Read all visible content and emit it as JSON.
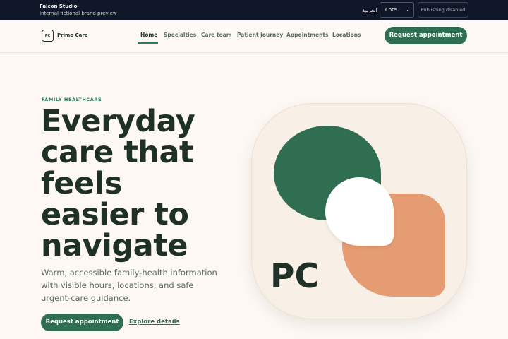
{
  "topbar": {
    "studio": "Falcon Studio",
    "preview": "Internal fictional brand preview",
    "language": "العربية",
    "theme_select": "Core",
    "publishing": "Publishing disabled"
  },
  "header": {
    "logo_initials": "PC",
    "brand_name": "Prime Care",
    "nav": [
      "Home",
      "Specialties",
      "Care team",
      "Patient journey",
      "Appointments",
      "Locations"
    ],
    "active_nav": "Home",
    "cta": "Request appointment"
  },
  "hero": {
    "eyebrow": "FAMILY HEALTHCARE",
    "headline_lines": [
      "Everyday",
      "care that",
      "feels",
      "easier to",
      "navigate"
    ],
    "lede": "Warm, accessible family-health information with visible hours, locations, and safe urgent-care guidance.",
    "primary_cta": "Request appointment",
    "secondary_link": "Explore details",
    "art_initials": "PC"
  },
  "colors": {
    "accent": "#2f6e50",
    "accent_orange": "#e59c72",
    "ink": "#1f3127",
    "background": "#fdf8f3",
    "topbar": "#0f1728"
  }
}
